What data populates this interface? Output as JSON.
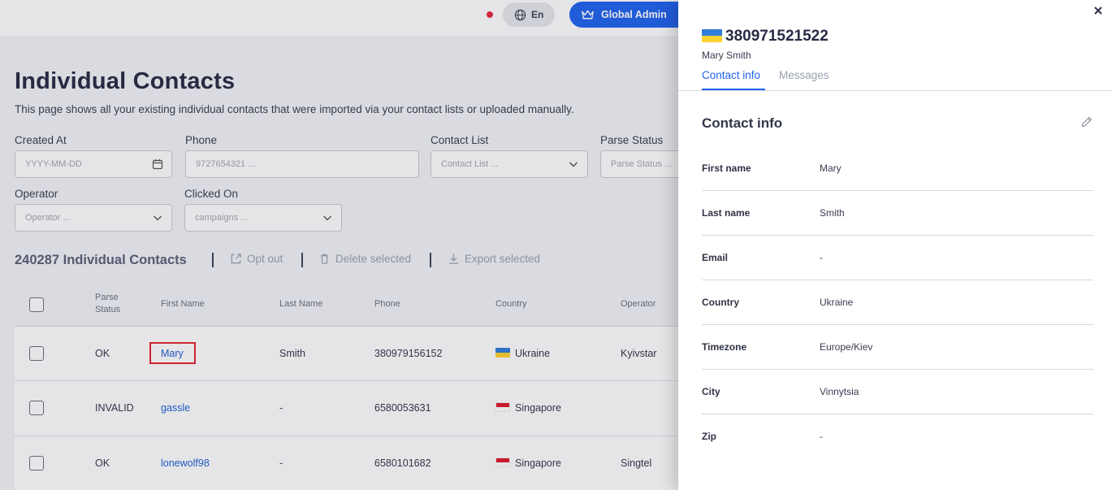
{
  "header": {
    "language": "En",
    "admin_label": "Global Admin"
  },
  "page": {
    "title": "Individual Contacts",
    "description": "This page shows all your existing individual contacts that were imported via your contact lists or uploaded manually."
  },
  "filters": {
    "created_at": {
      "label": "Created At",
      "placeholder": "YYYY-MM-DD"
    },
    "phone": {
      "label": "Phone",
      "placeholder": "9727654321 ..."
    },
    "contact_list": {
      "label": "Contact List",
      "placeholder": "Contact List ..."
    },
    "parse_status": {
      "label": "Parse Status",
      "placeholder": "Parse Status ..."
    },
    "operator": {
      "label": "Operator",
      "placeholder": "Operator ..."
    },
    "clicked_on": {
      "label": "Clicked On",
      "placeholder": "campaigns ..."
    }
  },
  "toolbar": {
    "count_title": "240287 Individual Contacts",
    "opt_out": "Opt out",
    "delete_selected": "Delete selected",
    "export_selected": "Export selected"
  },
  "table": {
    "columns": {
      "parse_status_1": "Parse",
      "parse_status_2": "Status",
      "first_name": "First Name",
      "last_name": "Last Name",
      "phone": "Phone",
      "country": "Country",
      "operator": "Operator"
    },
    "rows": [
      {
        "parse_status": "OK",
        "first_name": "Mary",
        "last_name": "Smith",
        "phone": "380979156152",
        "country": "Ukraine",
        "operator": "Kyivstar"
      },
      {
        "parse_status": "INVALID",
        "first_name": "gassle",
        "last_name": "-",
        "phone": "6580053631",
        "country": "Singapore",
        "operator": ""
      },
      {
        "parse_status": "OK",
        "first_name": "lonewolf98",
        "last_name": "-",
        "phone": "6580101682",
        "country": "Singapore",
        "operator": "Singtel"
      }
    ]
  },
  "drawer": {
    "phone": "380971521522",
    "name": "Mary Smith",
    "tabs": {
      "contact_info": "Contact info",
      "messages": "Messages"
    },
    "section_title": "Contact info",
    "fields": [
      {
        "label": "First name",
        "value": "Mary"
      },
      {
        "label": "Last name",
        "value": "Smith"
      },
      {
        "label": "Email",
        "value": "-"
      },
      {
        "label": "Country",
        "value": "Ukraine"
      },
      {
        "label": "Timezone",
        "value": "Europe/Kiev"
      },
      {
        "label": "City",
        "value": "Vinnytsia"
      },
      {
        "label": "Zip",
        "value": "-"
      }
    ]
  },
  "colors": {
    "accent": "#1f62ee",
    "highlight": "#e5232f",
    "notification": "#e8293f"
  }
}
